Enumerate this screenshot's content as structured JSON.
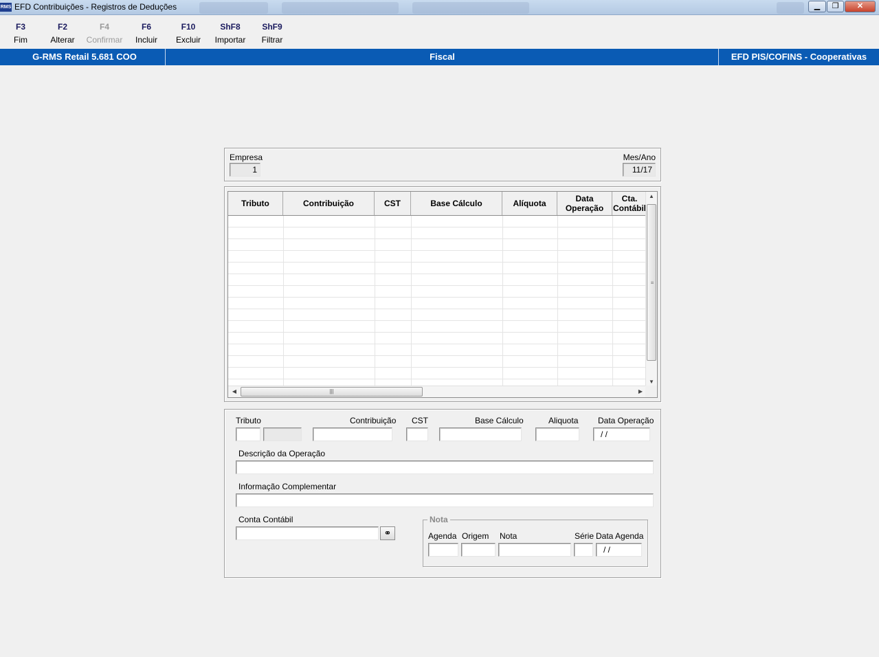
{
  "window": {
    "title": "EFD Contribuições - Registros de Deduções",
    "app_icon": "RMS",
    "controls": {
      "minimize": "minimize-icon",
      "restore": "restore-icon",
      "close": "close-icon"
    }
  },
  "toolbar": [
    {
      "key": "F3",
      "label": "Fim",
      "enabled": true
    },
    {
      "key": "F2",
      "label": "Alterar",
      "enabled": true
    },
    {
      "key": "F4",
      "label": "Confirmar",
      "enabled": false
    },
    {
      "key": "F6",
      "label": "Incluir",
      "enabled": true
    },
    {
      "key": "F10",
      "label": "Excluir",
      "enabled": true
    },
    {
      "key": "ShF8",
      "label": "Importar",
      "enabled": true
    },
    {
      "key": "ShF9",
      "label": "Filtrar",
      "enabled": true
    }
  ],
  "statusbar": {
    "system": "G-RMS Retail 5.681 COO",
    "module": "Fiscal",
    "program": "EFD PIS/COFINS - Cooperativas"
  },
  "header": {
    "empresa_label": "Empresa",
    "empresa_value": "1",
    "mesano_label": "Mes/Ano",
    "mesano_value": "11/17"
  },
  "grid": {
    "columns": [
      "Tributo",
      "Contribuição",
      "CST",
      "Base Cálculo",
      "Alíquota",
      "Data Operação",
      "Cta. Contábil"
    ],
    "rows": []
  },
  "detail": {
    "tributo_label": "Tributo",
    "contribuicao_label": "Contribuição",
    "cst_label": "CST",
    "base_calculo_label": "Base Cálculo",
    "aliquota_label": "Aliquota",
    "data_operacao_label": "Data Operação",
    "data_operacao_value": "/ /",
    "descricao_label": "Descrição da Operação",
    "info_label": "Informação Complementar",
    "conta_label": "Conta Contábil",
    "conta_search_icon": "binoculars-icon",
    "nota": {
      "title": "Nota",
      "agenda_label": "Agenda",
      "origem_label": "Origem",
      "nota_label": "Nota",
      "serie_label": "Série",
      "data_agenda_label": "Data Agenda",
      "data_agenda_value": "/ /"
    }
  }
}
